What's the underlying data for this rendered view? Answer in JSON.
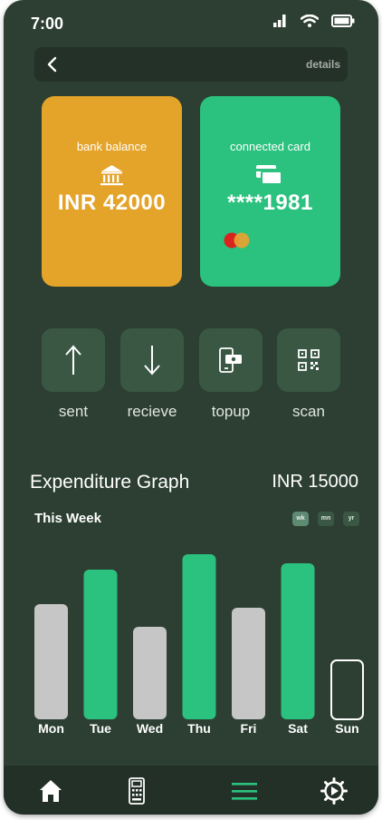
{
  "status": {
    "time": "7:00"
  },
  "topbar": {
    "details_label": "details"
  },
  "bank_card": {
    "label": "bank balance",
    "amount": "INR 42000",
    "icon": "bank-icon"
  },
  "connected_card": {
    "label": "connected card",
    "number": "****1981",
    "icon": "cards-icon"
  },
  "actions": [
    {
      "label": "sent",
      "icon": "arrow-up-icon"
    },
    {
      "label": "recieve",
      "icon": "arrow-down-icon"
    },
    {
      "label": "topup",
      "icon": "topup-icon"
    },
    {
      "label": "scan",
      "icon": "qr-scan-icon"
    }
  ],
  "expenditure": {
    "title": "Expenditure Graph",
    "total": "INR 15000",
    "period_label": "This Week",
    "toggles": [
      "wk",
      "mn",
      "yr"
    ],
    "selected_toggle": "wk"
  },
  "chart_data": {
    "type": "bar",
    "categories": [
      "Mon",
      "Tue",
      "Wed",
      "Thu",
      "Fri",
      "Sat",
      "Sun"
    ],
    "values": [
      127,
      165,
      102,
      182,
      123,
      172,
      65
    ],
    "highlighted": [
      false,
      true,
      false,
      true,
      false,
      true,
      false
    ],
    "colors": {
      "highlight": "#2bc17e",
      "normal": "#c6c6c6",
      "current_outline": "#ffffff"
    },
    "current_day": "Sun",
    "ylim": [
      0,
      182
    ]
  },
  "nav": [
    {
      "icon": "home-icon"
    },
    {
      "icon": "pos-terminal-icon"
    },
    {
      "icon": "menu-icon",
      "active": true
    },
    {
      "icon": "settings-icon"
    }
  ],
  "colors": {
    "background": "#2c3f32",
    "bank_card": "#e4a329",
    "connected_card": "#2bc17e",
    "button": "#3a5744"
  }
}
